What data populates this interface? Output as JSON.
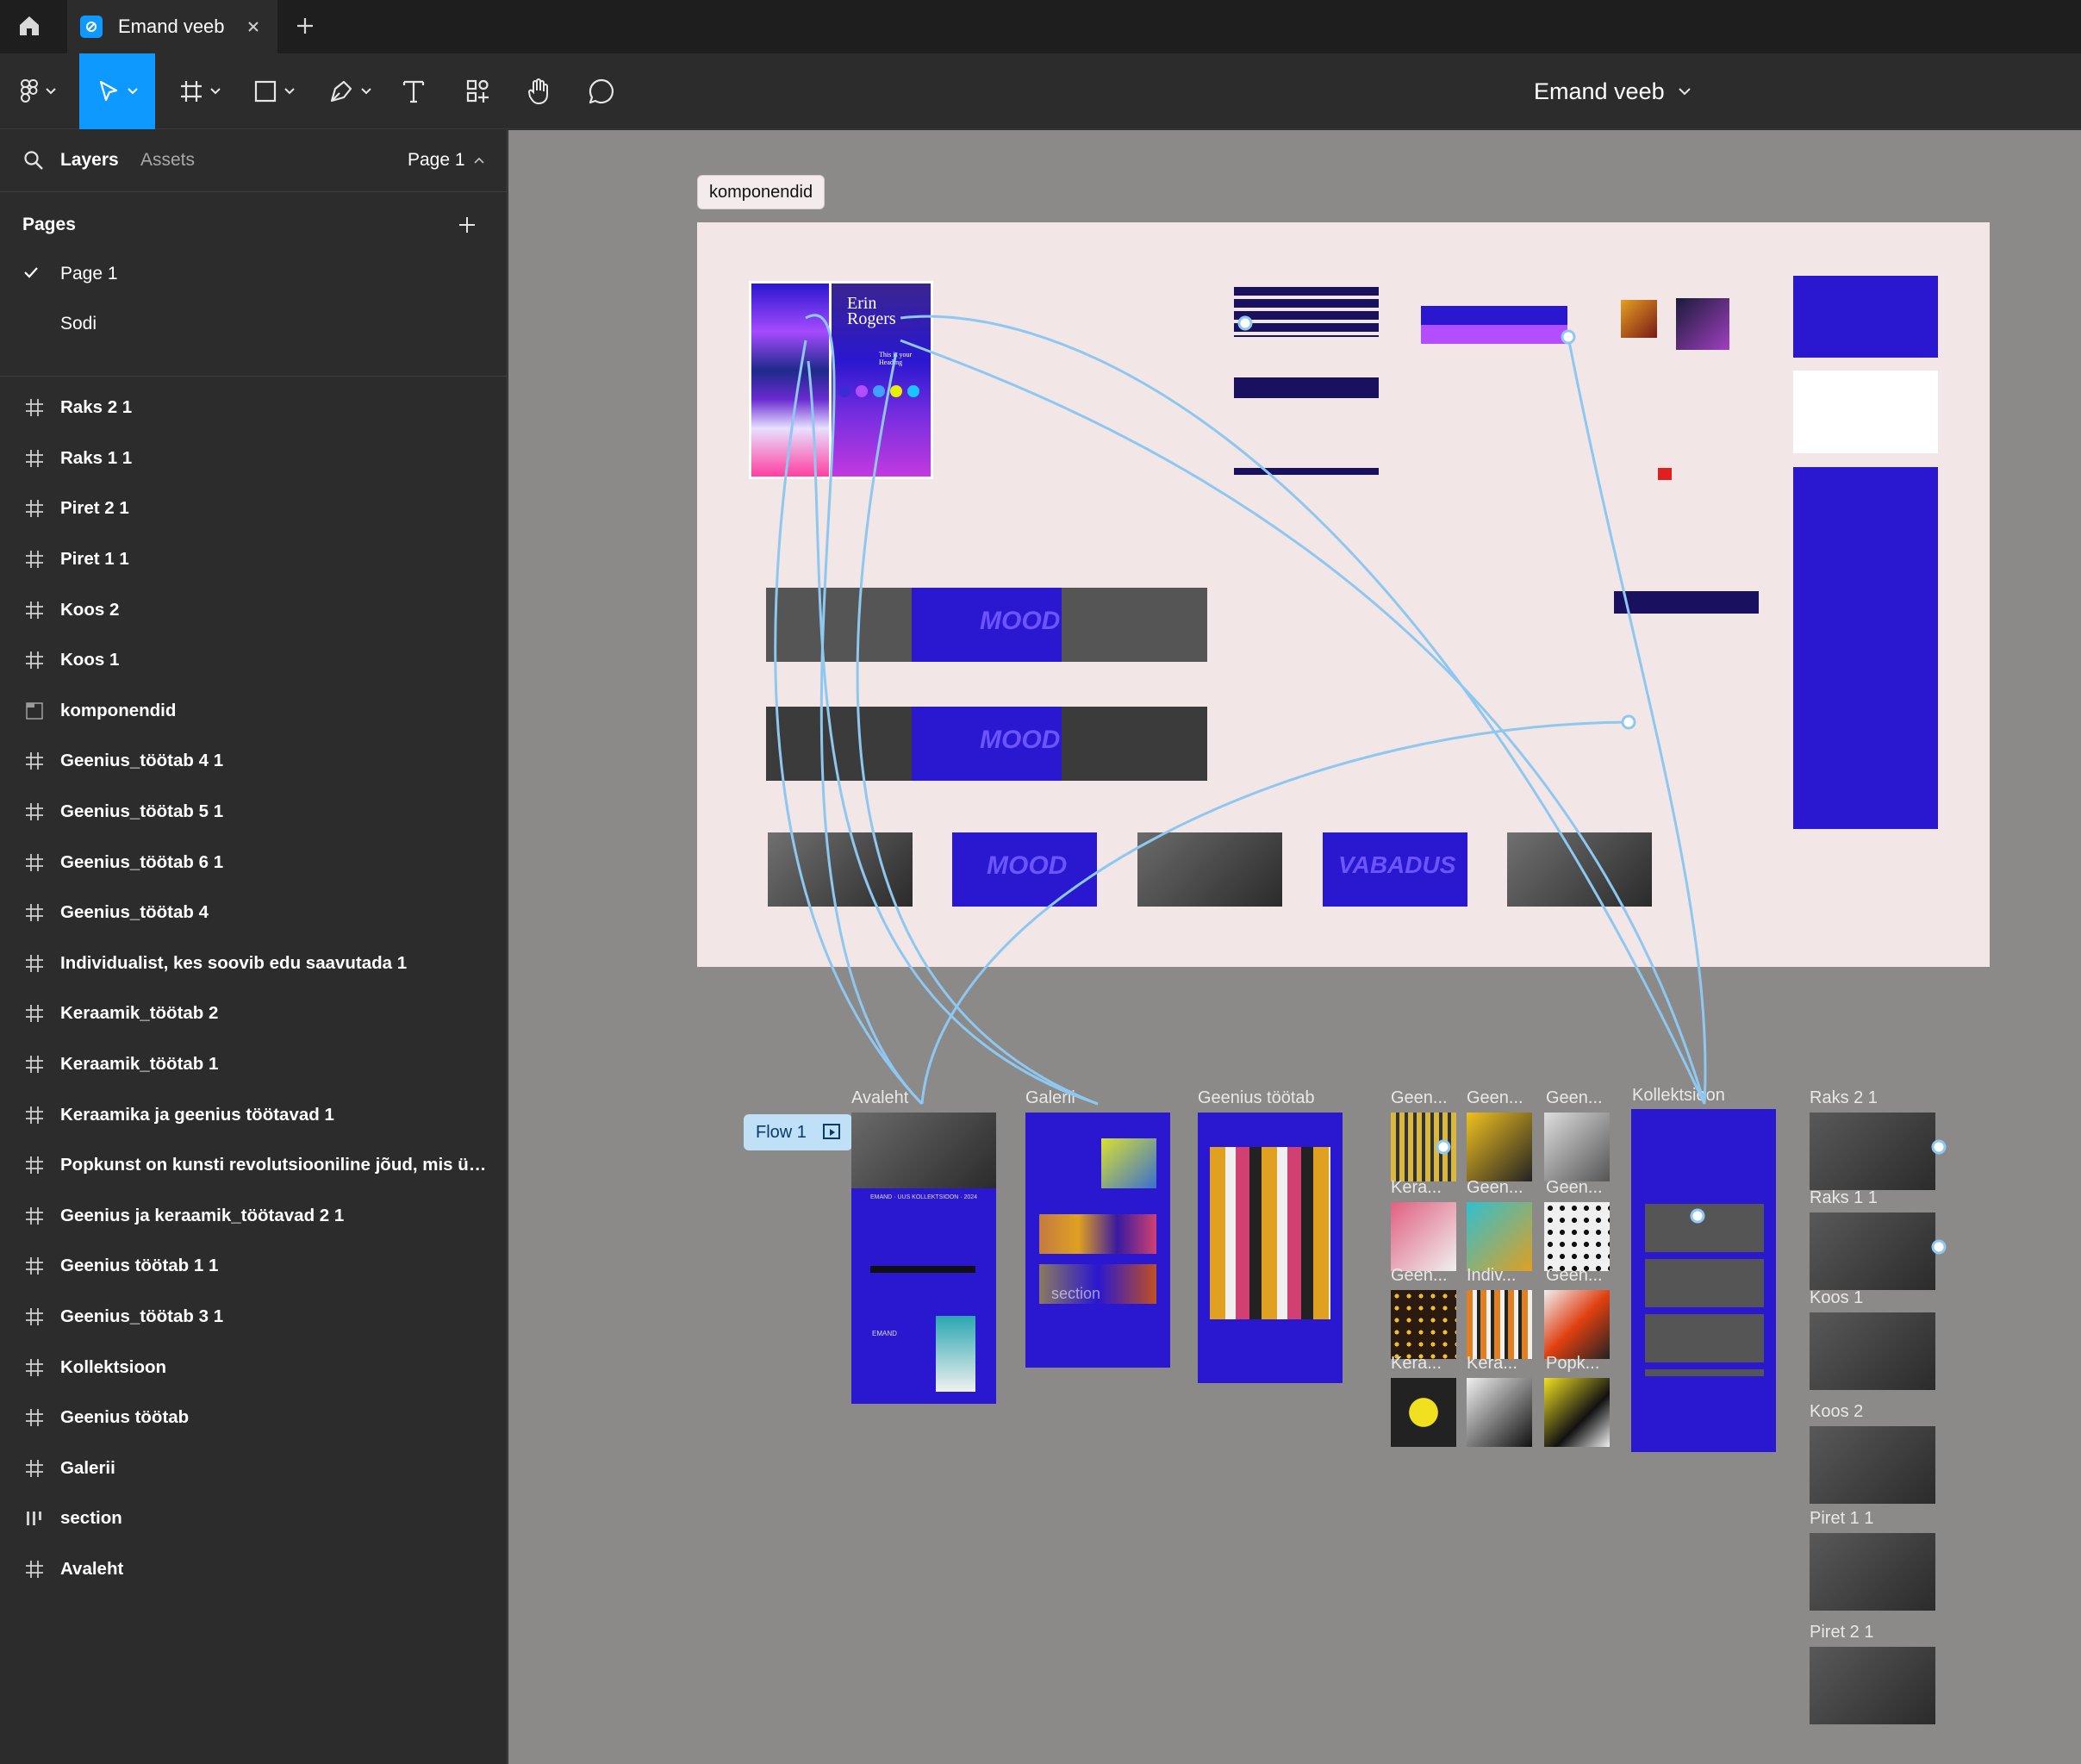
{
  "titlebar": {
    "file_tab_label": "Emand veeb"
  },
  "toolbar": {
    "doc_title": "Emand veeb",
    "tools": [
      "main-menu-icon",
      "move-icon",
      "frame-icon",
      "rectangle-icon",
      "pen-icon",
      "text-icon",
      "resources-icon",
      "hand-icon",
      "comment-icon"
    ]
  },
  "panel": {
    "tab_layers": "Layers",
    "tab_assets": "Assets",
    "page_selector": "Page 1",
    "pages_title": "Pages",
    "pages": [
      "Page 1",
      "Sodi"
    ],
    "layers": [
      {
        "label": "Raks 2 1",
        "icon": "frame-icon"
      },
      {
        "label": "Raks 1 1",
        "icon": "frame-icon"
      },
      {
        "label": "Piret 2 1",
        "icon": "frame-icon"
      },
      {
        "label": "Piret 1 1",
        "icon": "frame-icon"
      },
      {
        "label": "Koos 2",
        "icon": "frame-icon"
      },
      {
        "label": "Koos 1",
        "icon": "frame-icon"
      },
      {
        "label": "komponendid",
        "icon": "section-icon"
      },
      {
        "label": "Geenius_töötab 4 1",
        "icon": "frame-icon"
      },
      {
        "label": "Geenius_töötab 5 1",
        "icon": "frame-icon"
      },
      {
        "label": "Geenius_töötab 6 1",
        "icon": "frame-icon"
      },
      {
        "label": "Geenius_töötab 4",
        "icon": "frame-icon"
      },
      {
        "label": "Individualist, kes soovib edu saavutada 1",
        "icon": "frame-icon"
      },
      {
        "label": "Keraamik_töötab 2",
        "icon": "frame-icon"
      },
      {
        "label": "Keraamik_töötab 1",
        "icon": "frame-icon"
      },
      {
        "label": "Keraamika ja geenius töötavad 1",
        "icon": "frame-icon"
      },
      {
        "label": "Popkunst on kunsti revolutsiooniline jõud, mis üh...",
        "icon": "frame-icon"
      },
      {
        "label": "Geenius ja keraamik_töötavad 2 1",
        "icon": "frame-icon"
      },
      {
        "label": "Geenius töötab 1 1",
        "icon": "frame-icon"
      },
      {
        "label": "Geenius_töötab 3 1",
        "icon": "frame-icon"
      },
      {
        "label": "Kollektsioon",
        "icon": "frame-icon"
      },
      {
        "label": "Geenius töötab",
        "icon": "frame-icon"
      },
      {
        "label": "Galerii",
        "icon": "frame-icon"
      },
      {
        "label": "section",
        "icon": "columns-icon"
      },
      {
        "label": "Avaleht",
        "icon": "frame-icon"
      }
    ]
  },
  "canvas": {
    "section_label": "komponendid",
    "flow_label": "Flow 1",
    "moodboard_title": "Erin Rogers",
    "moodboard_heading": "This is your Heading",
    "slider_text_mood": "MOOD",
    "slider_text_vabadus": "VABADUS",
    "frames": {
      "avaleht": "Avaleht",
      "galerii": "Galerii",
      "geenius_tootab": "Geenius töötab",
      "geen1": "Geen...",
      "geen2": "Geen...",
      "geen3": "Geen...",
      "kera1": "Kera...",
      "geen4": "Geen...",
      "geen5": "Geen...",
      "geen6": "Geen...",
      "indiv": "Indiv...",
      "geen7": "Geen...",
      "kera2": "Kera...",
      "kera3": "Kera...",
      "popk": "Popk...",
      "kollektsioon": "Kollektsioon",
      "raks21": "Raks 2 1",
      "raks11": "Raks 1 1",
      "koos1": "Koos 1",
      "koos2": "Koos 2",
      "piret11": "Piret 1 1",
      "piret21": "Piret 2 1"
    },
    "avaleht_banner": "EMAND · UUS KOLLEKTSIOON · 2024",
    "avaleht_brand": "EMAND",
    "galerii_section": "section",
    "colors": {
      "canvas_bg": "#8c8989",
      "section_bg": "#f3e6e6",
      "site_blue": "#2a17d0",
      "flow_line": "#8ec8f0",
      "accent": "#0d99ff"
    }
  }
}
